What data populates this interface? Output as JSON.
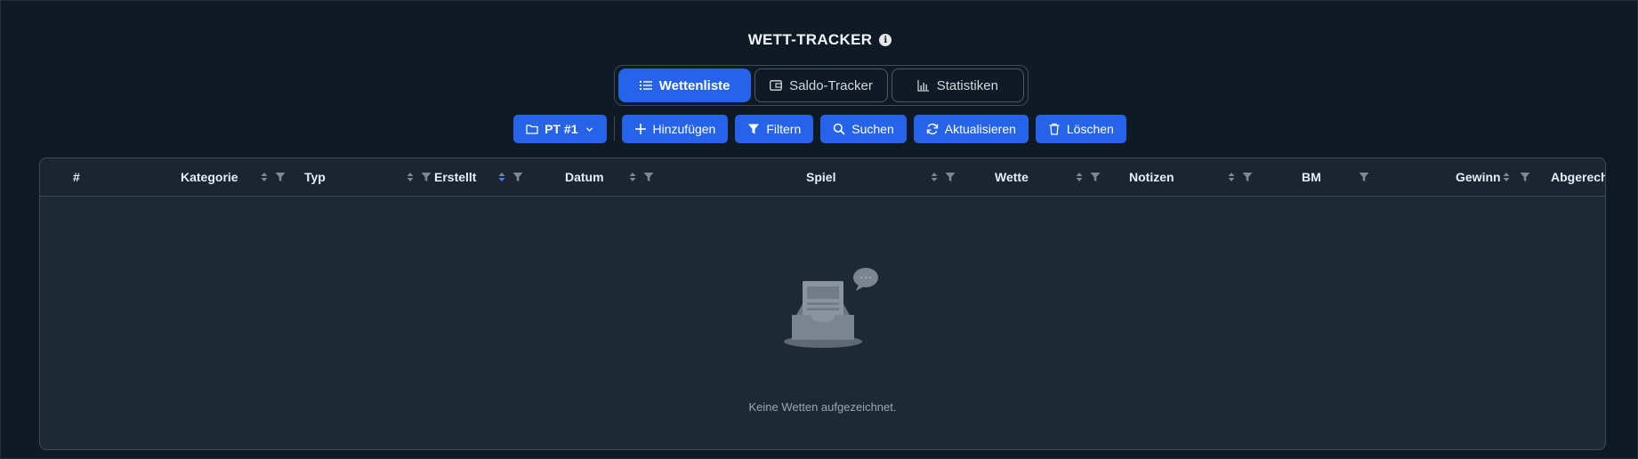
{
  "header": {
    "title": "WETT-TRACKER",
    "info_glyph": "i"
  },
  "tabs": [
    {
      "label": "Wettenliste",
      "icon": "list-icon",
      "active": true
    },
    {
      "label": "Saldo-Tracker",
      "icon": "wallet-icon",
      "active": false
    },
    {
      "label": "Statistiken",
      "icon": "bar-chart-icon",
      "active": false
    }
  ],
  "toolbar": {
    "profile_label": "PT #1",
    "add_label": "Hinzufügen",
    "filter_label": "Filtern",
    "search_label": "Suchen",
    "refresh_label": "Aktualisieren",
    "delete_label": "Löschen"
  },
  "table": {
    "columns": [
      {
        "label": "#"
      },
      {
        "label": "Kategorie"
      },
      {
        "label": "Typ"
      },
      {
        "label": "Erstellt"
      },
      {
        "label": "Datum"
      },
      {
        "label": "Spiel"
      },
      {
        "label": "Wette"
      },
      {
        "label": "Notizen"
      },
      {
        "label": "BM"
      },
      {
        "label": "Gewinn"
      },
      {
        "label": "Abgerechnet"
      }
    ],
    "empty_text": "Keine Wetten aufgezeichnet.",
    "sorted_column": "Erstellt"
  },
  "colors": {
    "accent": "#2563eb",
    "background": "#0f1a24",
    "panel": "#1e2936"
  }
}
